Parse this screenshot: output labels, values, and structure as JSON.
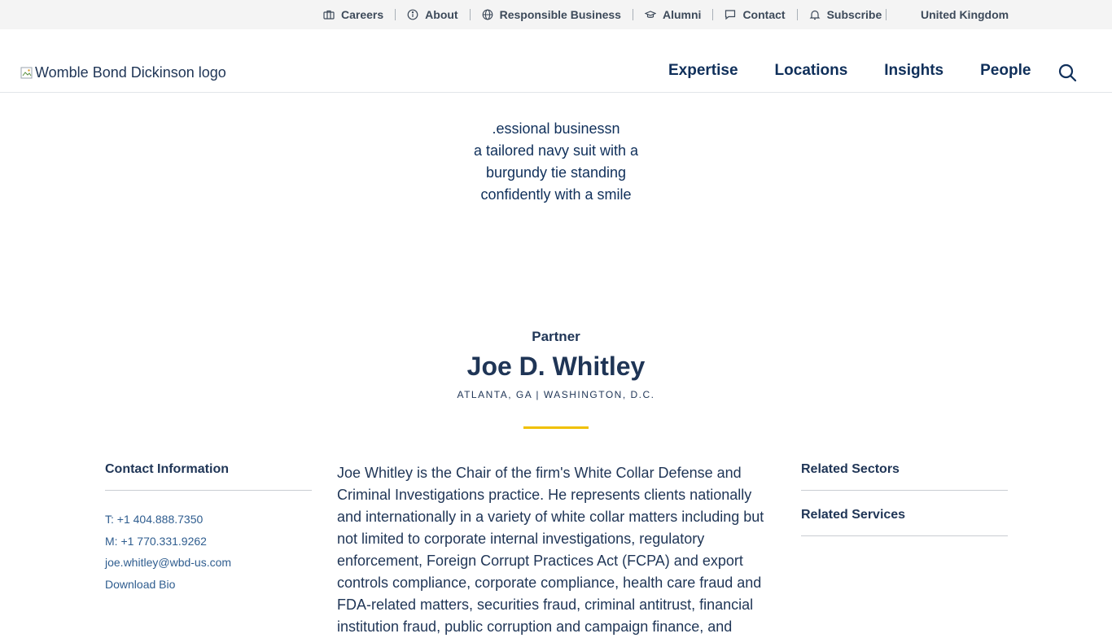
{
  "utility_nav": {
    "items": [
      {
        "label": "Careers",
        "icon": "briefcase-icon"
      },
      {
        "label": "About",
        "icon": "info-icon"
      },
      {
        "label": "Responsible Business",
        "icon": "globe-icon"
      },
      {
        "label": "Alumni",
        "icon": "graduation-cap-icon"
      },
      {
        "label": "Contact",
        "icon": "chat-icon"
      },
      {
        "label": "Subscribe",
        "icon": "bell-icon"
      }
    ],
    "region": "United Kingdom"
  },
  "header": {
    "logo_alt": "Womble Bond Dickinson logo",
    "nav": [
      "Expertise",
      "Locations",
      "Insights",
      "People"
    ]
  },
  "portrait": {
    "alt_lines": [
      ".essional businessn",
      "a tailored navy suit with a",
      "burgundy tie standing",
      "confidently with a smile"
    ]
  },
  "profile": {
    "role": "Partner",
    "name": "Joe D. Whitley",
    "locations": "ATLANTA, GA | WASHINGTON, D.C."
  },
  "contact": {
    "heading": "Contact Information",
    "telephone": "T: +1 404.888.7350",
    "mobile": "M: +1 770.331.9262",
    "email": "joe.whitley@wbd-us.com",
    "download": "Download Bio"
  },
  "bio": {
    "text": "Joe Whitley is the Chair of the firm's White Collar Defense and Criminal Investigations practice. He represents clients nationally and internationally in a variety of white collar matters including but not limited to corporate internal investigations, regulatory enforcement, Foreign Corrupt Practices Act (FCPA) and export controls compliance, corporate compliance, health care fraud and FDA-related matters, securities fraud, criminal antitrust, financial institution fraud, public corruption and campaign finance, and"
  },
  "related": {
    "sectors": "Related Sectors",
    "services": "Related Services"
  },
  "colors": {
    "navy": "#0f2f5a",
    "text": "#1f3556",
    "link": "#2f5d8f",
    "gold": "#f0c000",
    "utility_bg": "#f4f4f4"
  }
}
